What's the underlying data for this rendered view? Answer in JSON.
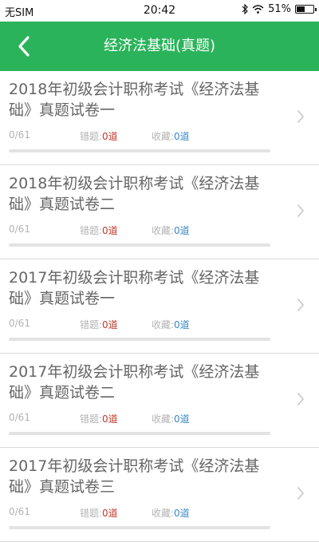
{
  "status_bar": {
    "carrier": "无SIM",
    "time": "20:42",
    "battery": "51%",
    "battery_level": 0.51,
    "icons": [
      "bluetooth-icon",
      "wifi-icon",
      "battery-icon"
    ]
  },
  "header": {
    "title": "经济法基础(真题)",
    "back_icon": "chevron-left-icon",
    "background": "#2bb35b"
  },
  "labels": {
    "wrong": "错题:",
    "favorites": "收藏:",
    "unit": "道"
  },
  "items": [
    {
      "title": "2018年初级会计职称考试《经济法基础》真题试卷一",
      "progress": "0/61",
      "progress_fraction": 0,
      "wrong_count": "0",
      "fav_count": "0"
    },
    {
      "title": "2018年初级会计职称考试《经济法基础》真题试卷二",
      "progress": "0/61",
      "progress_fraction": 0,
      "wrong_count": "0",
      "fav_count": "0"
    },
    {
      "title": "2017年初级会计职称考试《经济法基础》真题试卷一",
      "progress": "0/61",
      "progress_fraction": 0,
      "wrong_count": "0",
      "fav_count": "0"
    },
    {
      "title": "2017年初级会计职称考试《经济法基础》真题试卷二",
      "progress": "0/61",
      "progress_fraction": 0,
      "wrong_count": "0",
      "fav_count": "0"
    },
    {
      "title": "2017年初级会计职称考试《经济法基础》真题试卷三",
      "progress": "0/61",
      "progress_fraction": 0,
      "wrong_count": "0",
      "fav_count": "0"
    }
  ]
}
